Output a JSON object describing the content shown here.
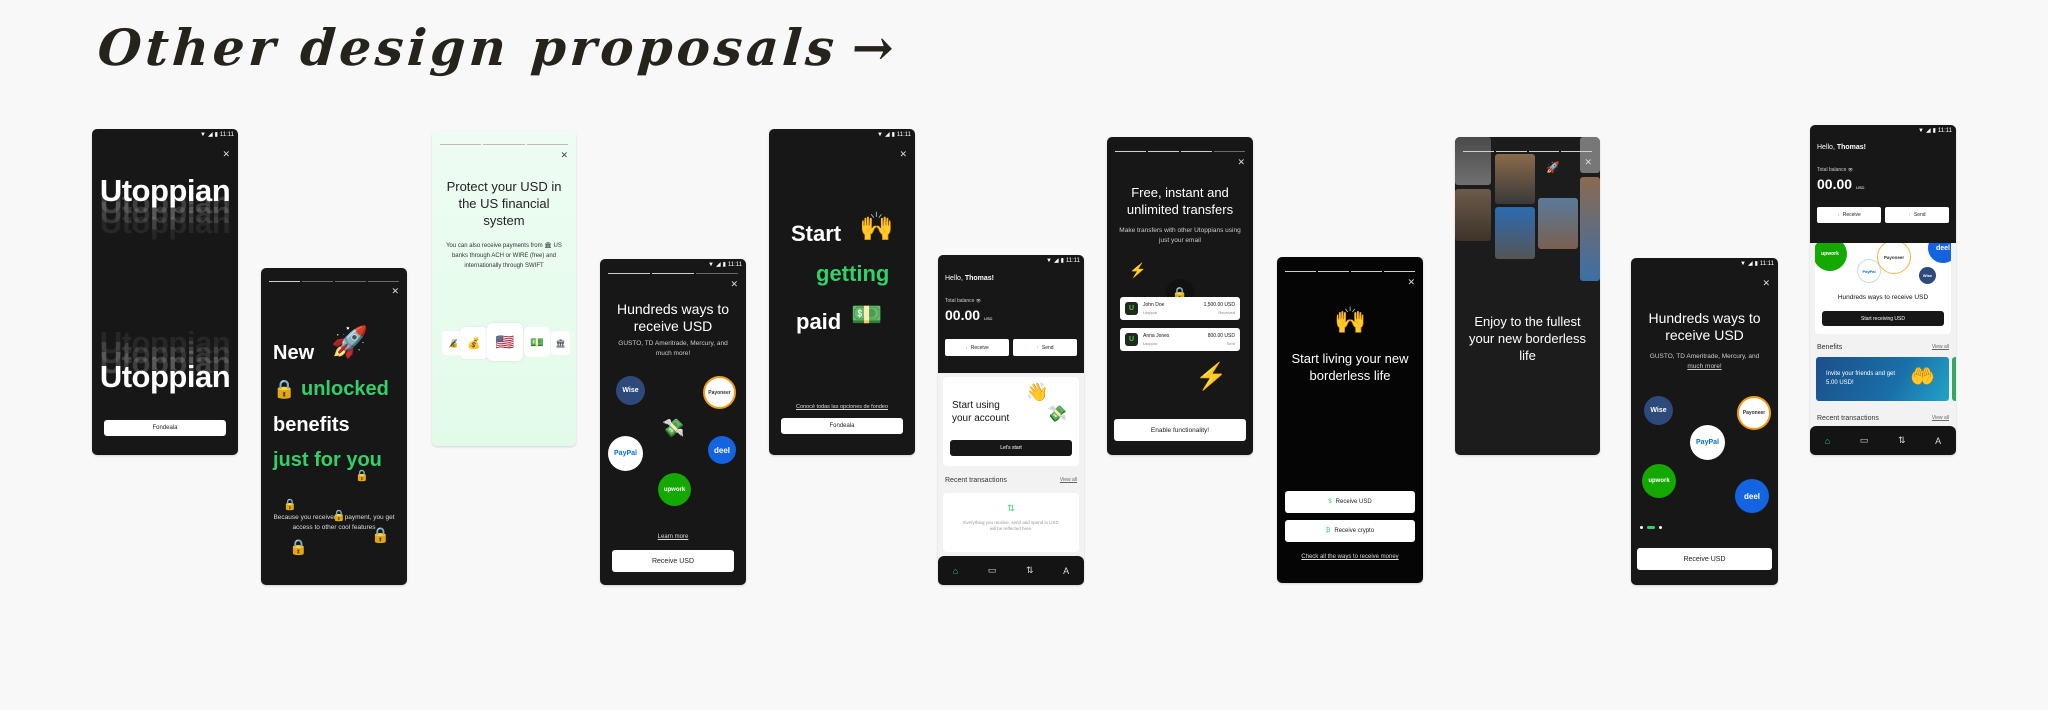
{
  "heading": "Other design proposals",
  "heading_arrow": "→",
  "status": {
    "time": "11:11",
    "wifi": "▼",
    "signal": "◢",
    "battery": "▮"
  },
  "close_glyph": "✕",
  "colors": {
    "accent_green": "#33d069",
    "dark_bg": "#171717",
    "light_green_bg": "#e8fbef",
    "wise": "#2e4a7a",
    "deel": "#1463e0",
    "upwork": "#14a800",
    "paypal": "#0070e0"
  },
  "screens": {
    "s1": {
      "word": "Utoppian",
      "button": "Fondeala"
    },
    "s2": {
      "line1": "New",
      "line2": "unlocked",
      "line3": "benefits",
      "line4": "just for you",
      "body": "Because you received a payment, you get access to other cool features",
      "emoji_rocket": "🚀",
      "emoji_lock": "🔒"
    },
    "s3": {
      "title": "Protect your USD in the US financial system",
      "body": "You can also receive payments from 🏛 US banks through ACH or WIRE (free) and internationally through SWIFT",
      "cards": [
        "🔏",
        "💰",
        "🇺🇸",
        "💵",
        "🏛"
      ]
    },
    "s4": {
      "title": "Hundreds ways to receive USD",
      "subtitle": "GUSTO, TD Ameritrade, Mercury, and much more!",
      "partners": [
        "Wise",
        "Payoneer",
        "PayPal",
        "deel",
        "upwork"
      ],
      "center_emoji": "💸",
      "link": "Learn more",
      "button": "Receive USD"
    },
    "s5": {
      "line1": "Start",
      "line2": "getting",
      "line3": "paid",
      "emoji_hands": "🙌",
      "emoji_money": "💵",
      "link": "Conocé todas las opciones de fondeo",
      "button": "Fondeala"
    },
    "s6": {
      "greeting_prefix": "Hello, ",
      "greeting_name": "Thomas!",
      "balance_label": "Total balance",
      "balance_eye": "👁",
      "balance": "00.00",
      "currency": "USD",
      "receive": "Receive",
      "send": "Send",
      "card_title": "Start using your account",
      "card_button": "Let's start",
      "emoji_wave": "👋",
      "emoji_money": "💸",
      "recent_label": "Recent transactions",
      "view_all": "View all",
      "empty_icon": "⇅",
      "empty_text": "Everything you receive, send and spend in USD will be reflected here.",
      "nav": [
        "⌂",
        "▭",
        "⇅",
        "A"
      ]
    },
    "s7": {
      "title": "Free, instant and unlimited transfers",
      "subtitle": "Make transfers with other Utoppians using just your email",
      "emoji_bolt": "⚡",
      "emoji_lock": "🔒",
      "transactions": [
        {
          "name": "John Doe",
          "org": "Utoppia",
          "amount": "1,500.00 USD",
          "status": "Received"
        },
        {
          "name": "Anna Jones",
          "org": "Utoppia",
          "amount": "800.00 USD",
          "status": "Sent"
        }
      ],
      "button": "Enable functionality!"
    },
    "s8": {
      "emoji_hands": "🙌",
      "title": "Start living your new borderless life",
      "btn_usd_icon": "$",
      "btn_usd": "Receive USD",
      "btn_crypto_icon": "₿",
      "btn_crypto": "Receive crypto",
      "link": "Check all the ways to receive money"
    },
    "s9": {
      "title": "Enjoy to the fullest your new borderless life",
      "emoji_rocket": "🚀"
    },
    "s10": {
      "title": "Hundreds ways to receive USD",
      "subtitle_prefix": "GUSTO, TD Ameritrade, Mercury, and ",
      "subtitle_link": "much more!",
      "partners": [
        "Wise",
        "Payoneer",
        "PayPal",
        "upwork",
        "deel"
      ],
      "button": "Receive USD",
      "page_index": 2,
      "page_count": 3
    },
    "s11": {
      "greeting_prefix": "Hello, ",
      "greeting_name": "Thomas!",
      "balance_label": "Total balance",
      "balance_eye": "👁",
      "balance": "00.00",
      "currency": "USD",
      "receive": "Receive",
      "send": "Send",
      "partners": [
        "upwork",
        "Payoneer",
        "deel",
        "PayPal",
        "Wise"
      ],
      "promo_title": "Hundreds ways to receive USD",
      "promo_button": "Start receiving USD",
      "benefits_label": "Benefits",
      "view_all": "View all",
      "benefit_card": "Invite your friends and get 5.00 USD!",
      "emoji_hands": "🤲",
      "recent_label": "Recent transactions",
      "nav": [
        "⌂",
        "▭",
        "⇅",
        "A"
      ]
    }
  }
}
